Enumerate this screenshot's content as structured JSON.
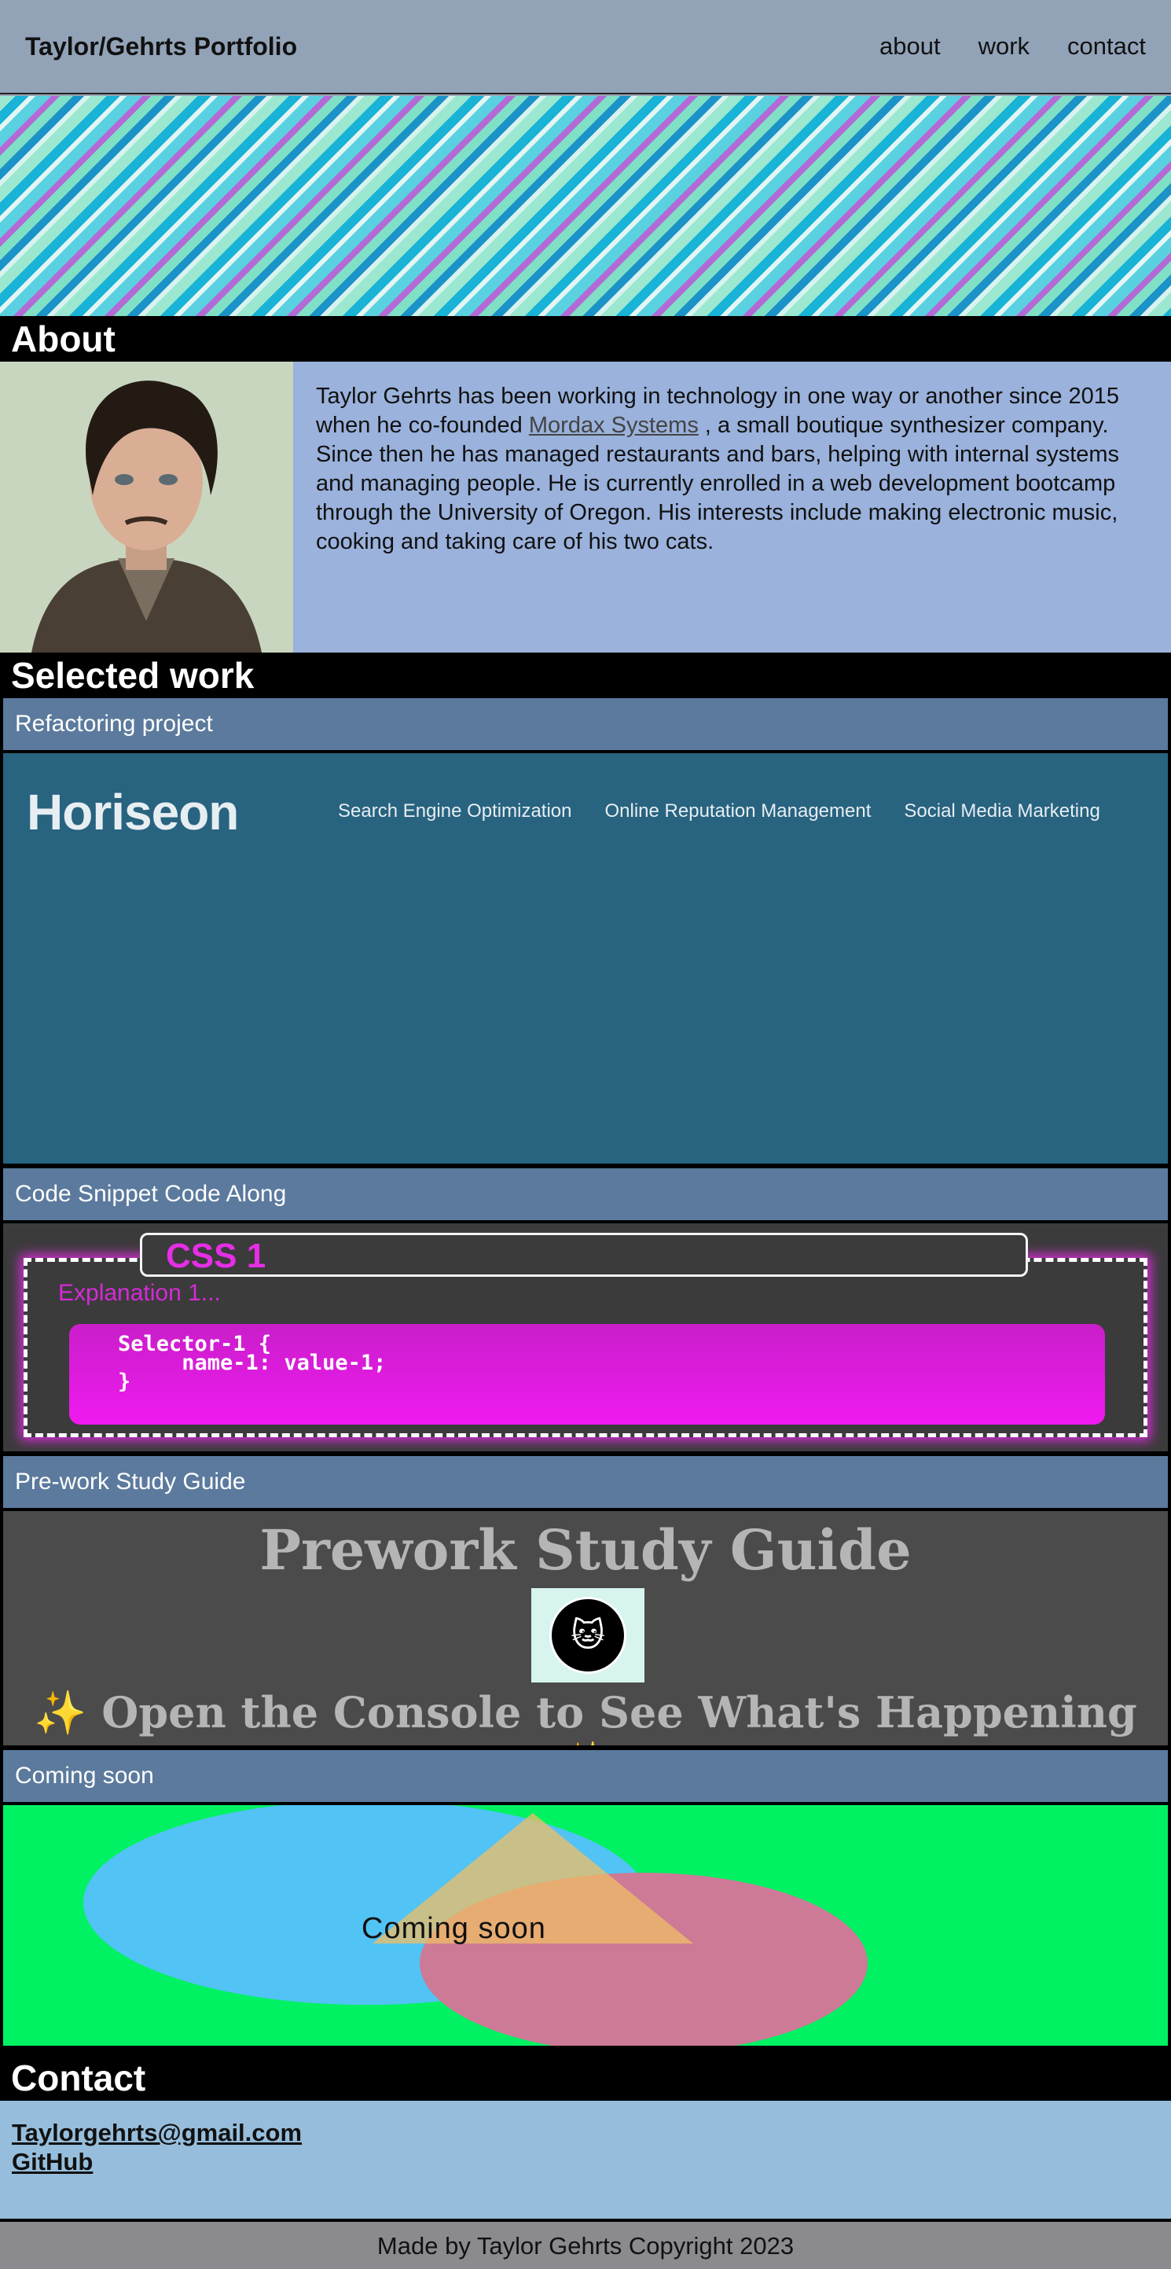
{
  "header": {
    "brand": "Taylor/Gehrts Portfolio",
    "nav": [
      "about",
      "work",
      "contact"
    ]
  },
  "about": {
    "title": "About",
    "text_before_link": "Taylor Gehrts has been working in technology in one way or another since 2015 when he co-founded ",
    "link_text": "Mordax Systems",
    "text_after_link": " , a small boutique synthesizer company. Since then he has managed restaurants and bars, helping with internal systems and managing people. He is currently enrolled in a web development bootcamp through the University of Oregon. His interests include making electronic music, cooking and taking care of his two cats."
  },
  "work": {
    "title": "Selected work",
    "projects": [
      {
        "label": "Refactoring project",
        "preview": {
          "logo": "Horiseon",
          "nav": [
            "Search Engine Optimization",
            "Online Reputation Management",
            "Social Media Marketing"
          ]
        }
      },
      {
        "label": "Code Snippet Code Along",
        "preview": {
          "tab": "CSS 1",
          "explanation": "Explanation 1...",
          "code": "Selector-1 {\n     name-1: value-1;\n}"
        }
      },
      {
        "label": "Pre-work Study Guide",
        "preview": {
          "title": "Prework Study Guide",
          "subtitle": "✨ Open the Console to See What's Happening ✨"
        }
      },
      {
        "label": "Coming soon",
        "preview": {
          "text": "Coming soon"
        }
      }
    ]
  },
  "contact": {
    "title": "Contact",
    "email": "Taylorgehrts@gmail.com",
    "github": "GitHub"
  },
  "footer": {
    "text": "Made by Taylor Gehrts Copyright 2023"
  }
}
